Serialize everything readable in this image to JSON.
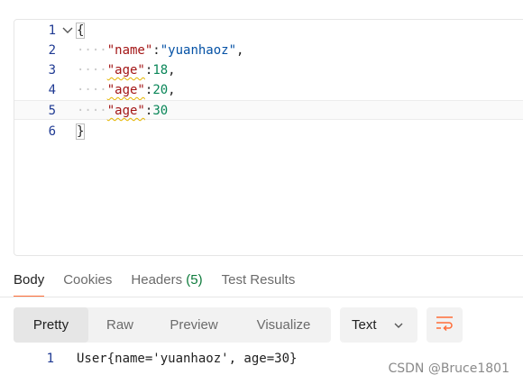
{
  "request_body": {
    "lines": [
      {
        "no": "1",
        "open": "{"
      },
      {
        "no": "2",
        "key": "\"name\"",
        "sep": ":",
        "str": "\"yuanhaoz\"",
        "end": ","
      },
      {
        "no": "3",
        "key": "\"age\"",
        "sep": ":",
        "num": "18",
        "end": ","
      },
      {
        "no": "4",
        "key": "\"age\"",
        "sep": ":",
        "num": "20",
        "end": ","
      },
      {
        "no": "5",
        "key": "\"age\"",
        "sep": ":",
        "num": "30",
        "end": ""
      },
      {
        "no": "6",
        "close": "}"
      }
    ]
  },
  "response": {
    "tabs": {
      "body": "Body",
      "cookies": "Cookies",
      "headers": "Headers",
      "headers_count": "(5)",
      "test_results": "Test Results"
    },
    "modes": {
      "pretty": "Pretty",
      "raw": "Raw",
      "preview": "Preview",
      "visualize": "Visualize"
    },
    "format": {
      "selected": "Text"
    },
    "body_lines": [
      {
        "no": "1",
        "text": "User{name='yuanhaoz', age=30}"
      }
    ]
  },
  "colors": {
    "accent": "#ff6c37",
    "key": "#a31515",
    "string": "#0451a5",
    "number": "#098658",
    "warning": "#e5b500"
  },
  "watermark": "CSDN @Bruce1801"
}
